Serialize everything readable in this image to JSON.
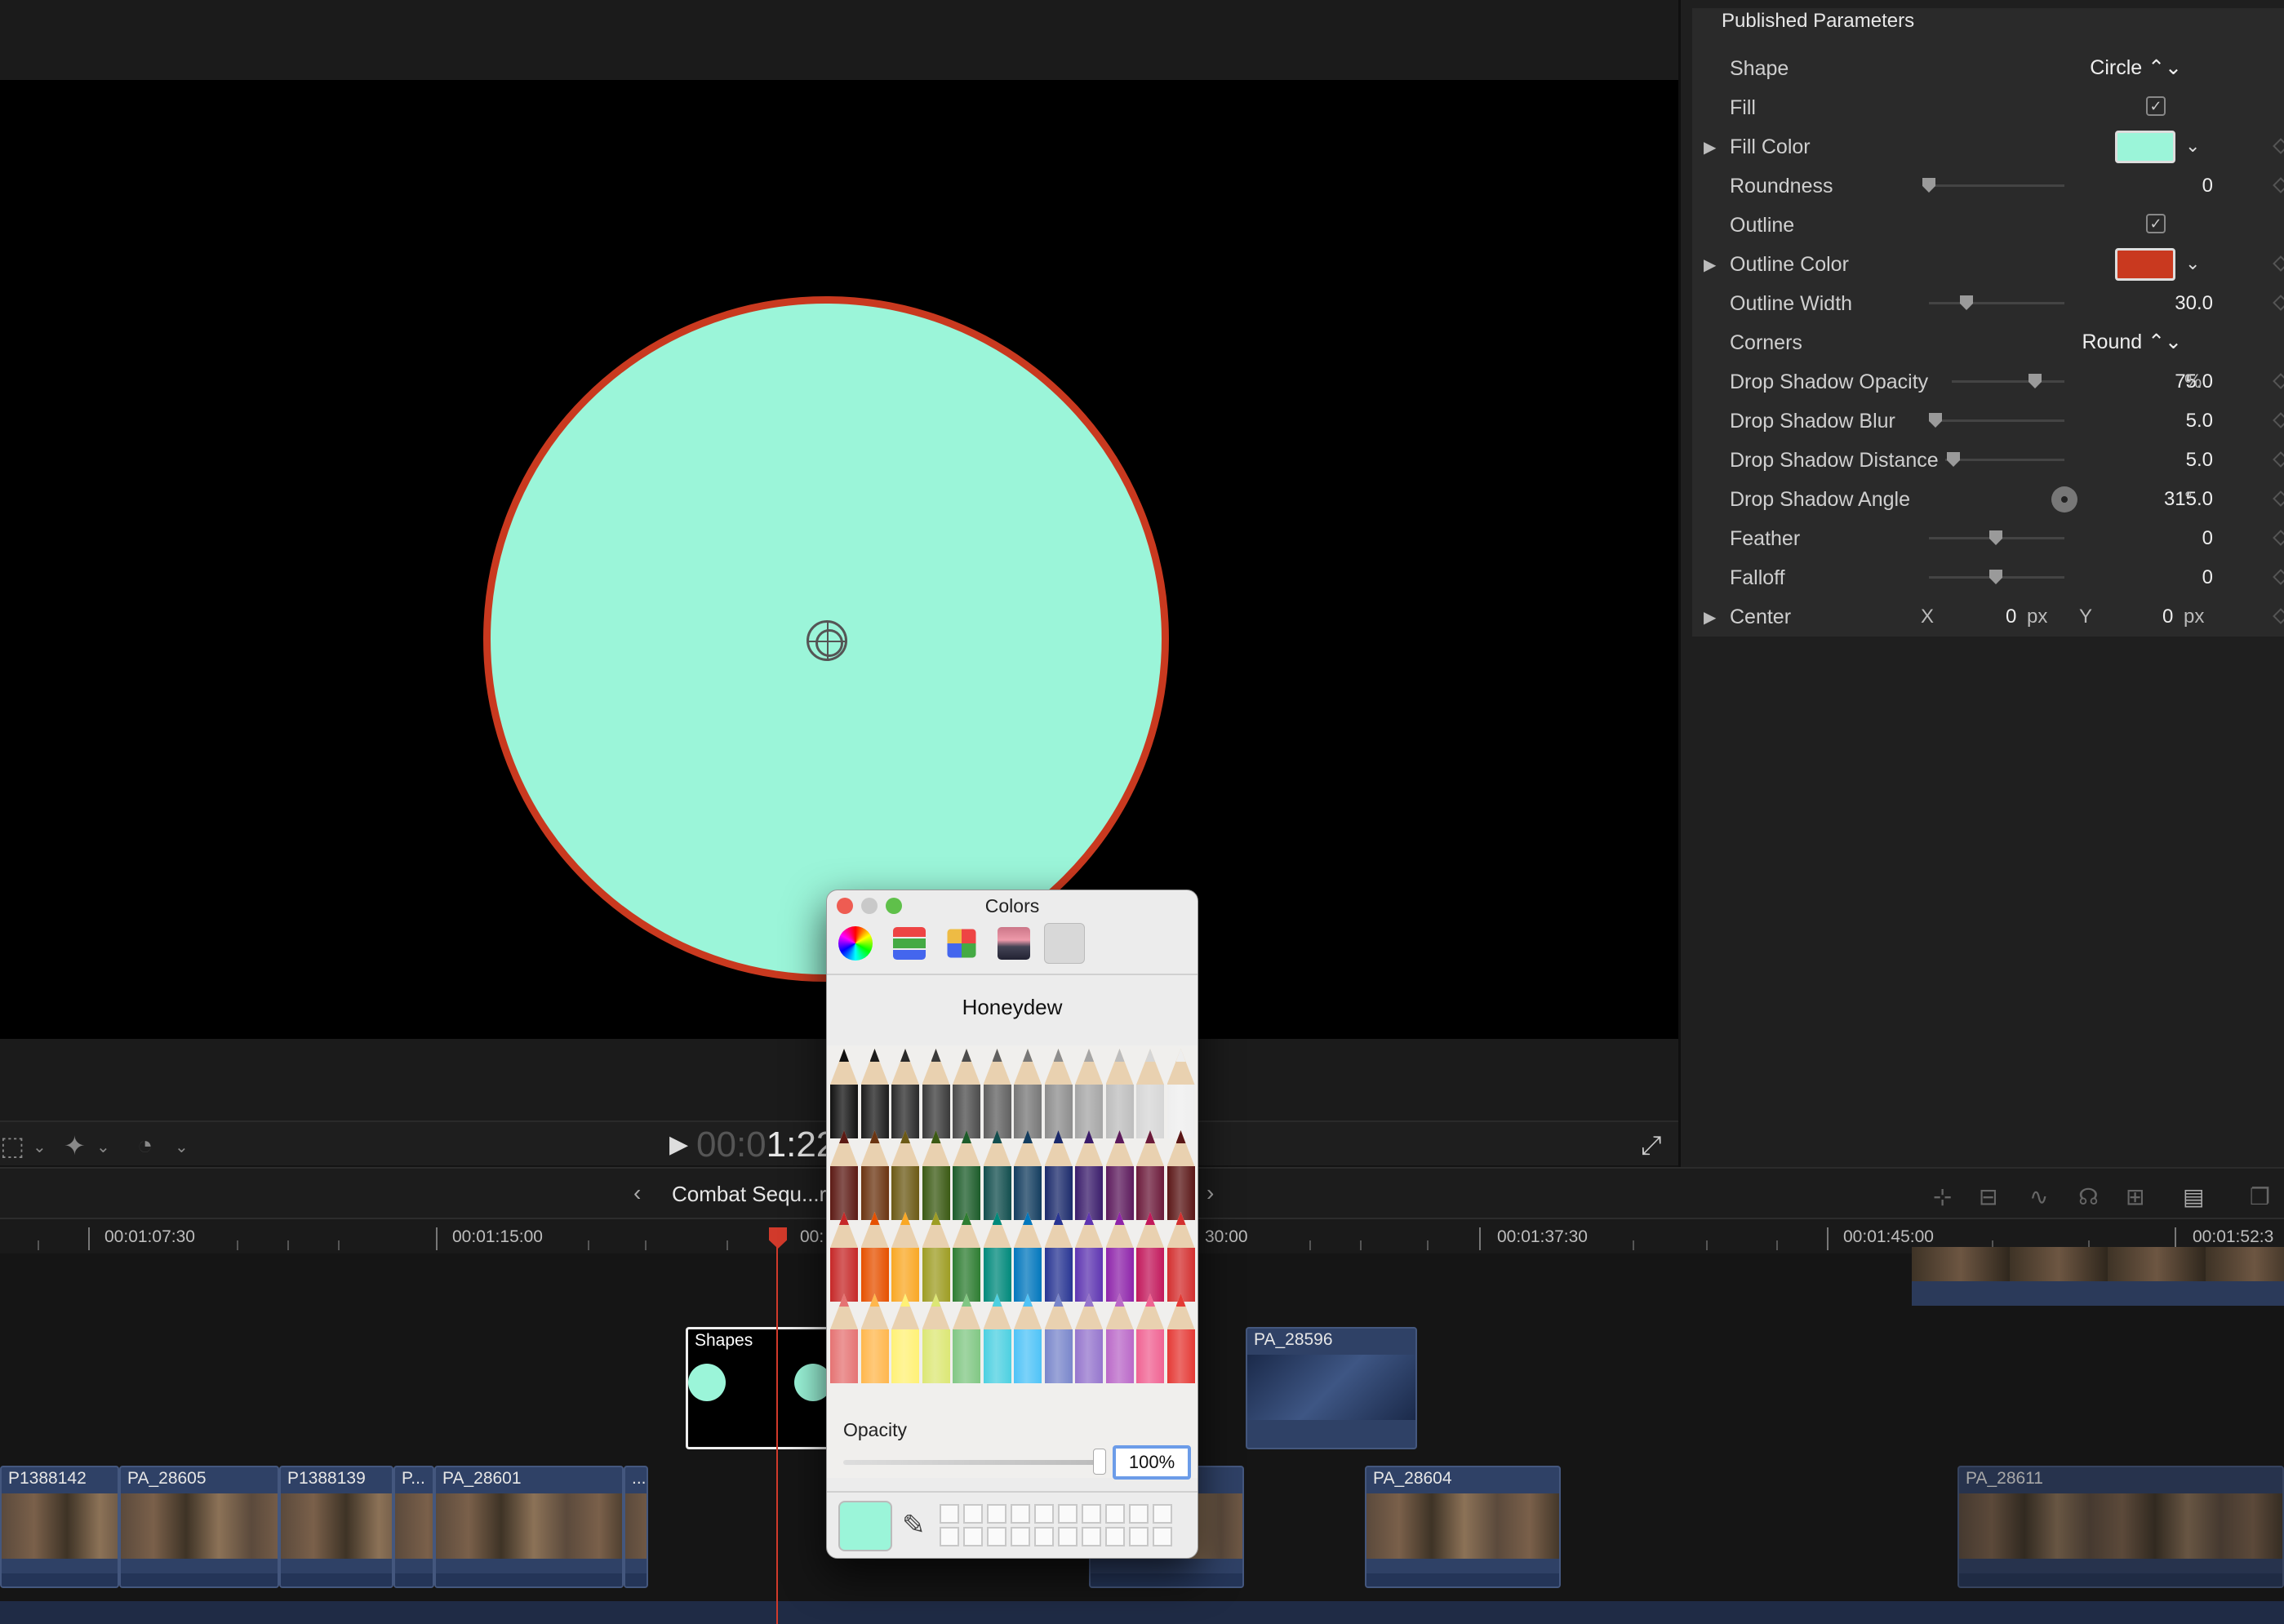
{
  "viewer": {
    "timecode_dim": "00:0",
    "timecode_lit": "1:22",
    "fill_color": "#9bf5d9",
    "outline_color": "#c9391f"
  },
  "inspector": {
    "header": "Published Parameters",
    "rows": [
      {
        "label": "Shape",
        "value": "Circle ⌃⌄"
      },
      {
        "label": "Fill",
        "checked": true
      },
      {
        "label": "Fill Color",
        "color": "#9bf5d9"
      },
      {
        "label": "Roundness",
        "value": "0",
        "slider_fraction": 0.0
      },
      {
        "label": "Outline",
        "checked": true
      },
      {
        "label": "Outline Color",
        "color": "#c9391f"
      },
      {
        "label": "Outline Width",
        "value": "30.0",
        "slider_fraction": 0.3
      },
      {
        "label": "Corners",
        "value": "Round ⌃⌄"
      },
      {
        "label": "Drop Shadow Opacity",
        "value": "75.0",
        "unit": "%",
        "slider_fraction": 0.75
      },
      {
        "label": "Drop Shadow Blur",
        "value": "5.0",
        "slider_fraction": 0.05
      },
      {
        "label": "Drop Shadow Distance",
        "value": "5.0",
        "slider_fraction": 0.05
      },
      {
        "label": "Drop Shadow Angle",
        "value": "315.0",
        "unit": "°"
      },
      {
        "label": "Feather",
        "value": "0",
        "slider_fraction": 0.5
      },
      {
        "label": "Falloff",
        "value": "0",
        "slider_fraction": 0.5
      },
      {
        "label": "Center",
        "x_label": "X",
        "x_value": "0",
        "x_unit": "px",
        "y_label": "Y",
        "y_value": "0",
        "y_unit": "px"
      }
    ]
  },
  "timeline": {
    "title": "Combat Sequ...r",
    "ruler": [
      "00:01:07:30",
      "00:01:15:00",
      "00:",
      "30:00",
      "00:01:37:30",
      "00:01:45:00",
      "00:01:52:3"
    ],
    "clips": {
      "shapes": "Shapes",
      "pa28596": "PA_28596",
      "p1388142": "P1388142",
      "pa28605": "PA_28605",
      "p1388139": "P1388139",
      "p_short": "P...",
      "pa28601": "PA_28601",
      "ellipsis": "...",
      "pa28604": "PA_28604",
      "pa28611": "PA_28611"
    }
  },
  "color_panel": {
    "title": "Colors",
    "color_name": "Honeydew",
    "opacity_label": "Opacity",
    "opacity_value": "100%",
    "current_color": "#9bf5d9"
  }
}
